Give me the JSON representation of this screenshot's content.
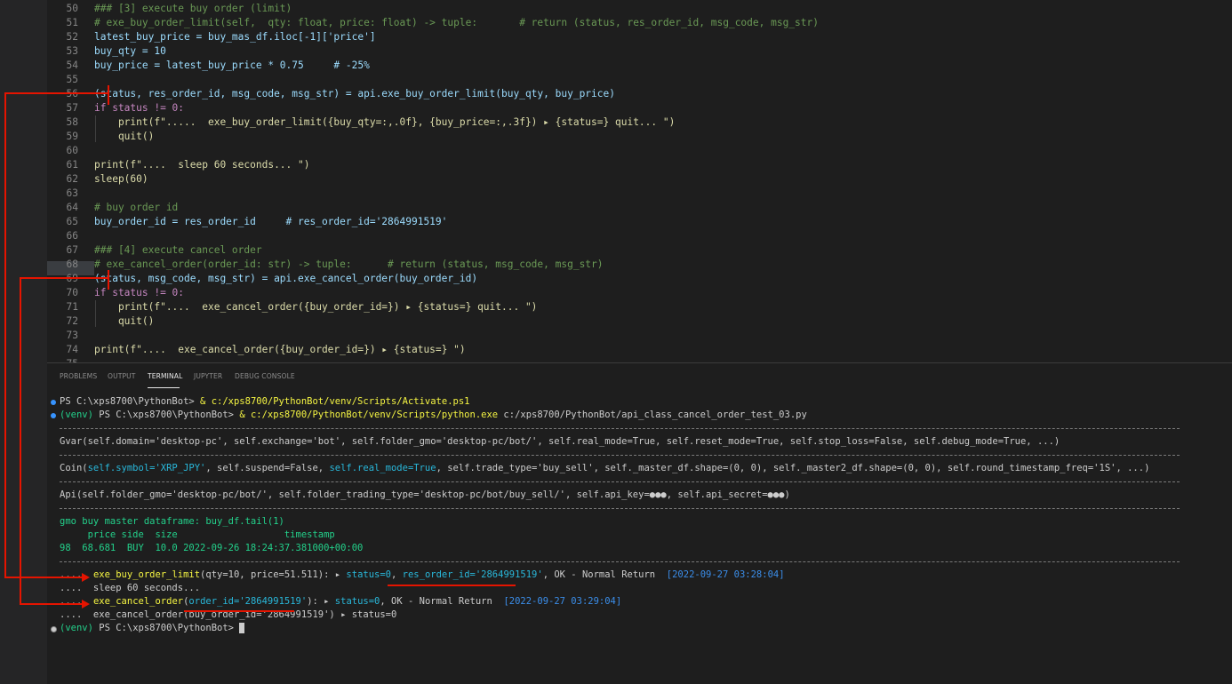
{
  "editor": {
    "lines": [
      {
        "n": "50",
        "text": "### [3] execute buy order (limit)"
      },
      {
        "n": "51",
        "text": "# exe_buy_order_limit(self,  qty: float, price: float) -> tuple:       # return (status, res_order_id, msg_code, msg_str)"
      },
      {
        "n": "52",
        "text": "latest_buy_price = buy_mas_df.iloc[-1]['price']"
      },
      {
        "n": "53",
        "text": "buy_qty = 10"
      },
      {
        "n": "54",
        "text": "buy_price = latest_buy_price * 0.75     # -25%"
      },
      {
        "n": "55",
        "text": ""
      },
      {
        "n": "56",
        "text": "(status, res_order_id, msg_code, msg_str) = api.exe_buy_order_limit(buy_qty, buy_price)"
      },
      {
        "n": "57",
        "text": "if status != 0:"
      },
      {
        "n": "58",
        "text": "    print(f\".....  exe_buy_order_limit({buy_qty=:,.0f}, {buy_price=:,.3f}) ▸ {status=} quit... \")"
      },
      {
        "n": "59",
        "text": "    quit()"
      },
      {
        "n": "60",
        "text": ""
      },
      {
        "n": "61",
        "text": "print(f\"....  sleep 60 seconds... \")"
      },
      {
        "n": "62",
        "text": "sleep(60)"
      },
      {
        "n": "63",
        "text": ""
      },
      {
        "n": "64",
        "text": "# buy order id"
      },
      {
        "n": "65",
        "text": "buy_order_id = res_order_id     # res_order_id='2864991519'"
      },
      {
        "n": "66",
        "text": ""
      },
      {
        "n": "67",
        "text": "### [4] execute cancel order"
      },
      {
        "n": "68",
        "text": "# exe_cancel_order(order_id: str) -> tuple:      # return (status, msg_code, msg_str)"
      },
      {
        "n": "69",
        "text": "(status, msg_code, msg_str) = api.exe_cancel_order(buy_order_id)"
      },
      {
        "n": "70",
        "text": "if status != 0:"
      },
      {
        "n": "71",
        "text": "    print(f\"....  exe_cancel_order({buy_order_id=}) ▸ {status=} quit... \")"
      },
      {
        "n": "72",
        "text": "    quit()"
      },
      {
        "n": "73",
        "text": ""
      },
      {
        "n": "74",
        "text": "print(f\"....  exe_cancel_order({buy_order_id=}) ▸ {status=} \")"
      },
      {
        "n": "75",
        "text": ""
      }
    ]
  },
  "panel": {
    "tabs": [
      "PROBLEMS",
      "OUTPUT",
      "TERMINAL",
      "JUPYTER",
      "DEBUG CONSOLE"
    ],
    "active_tab": "TERMINAL"
  },
  "terminal": {
    "l1_prompt": "PS C:\\xps8700\\PythonBot> ",
    "l1_cmd": "& c:/xps8700/PythonBot/venv/Scripts/Activate.ps1",
    "l2_venv": "(venv)",
    "l2_prompt": " PS C:\\xps8700\\PythonBot> ",
    "l2_cmd": "& c:/xps8700/PythonBot/venv/Scripts/python.exe",
    "l2_arg": " c:/xps8700/PythonBot/api_class_cancel_order_test_03.py",
    "gvar": "Gvar(self.domain='desktop-pc', self.exchange='bot', self.folder_gmo='desktop-pc/bot/', self.real_mode=True, self.reset_mode=True, self.stop_loss=False, self.debug_mode=True, ...)",
    "coin_a": "Coin(",
    "coin_b": "self.symbol='XRP_JPY'",
    "coin_c": ", self.suspend=False, ",
    "coin_d": "self.real_mode=True",
    "coin_e": ", self.trade_type='buy_sell', self._master_df.shape=(0, 0), self._master2_df.shape=(0, 0), self.round_timestamp_freq='1S', ...)",
    "api": "Api(self.folder_gmo='desktop-pc/bot/', self.folder_trading_type='desktop-pc/bot/buy_sell/', self.api_key=●●●, self.api_secret=●●●)",
    "df_title": "gmo buy master dataframe: buy_df.tail(1)",
    "df_header": "     price side  size                   timestamp",
    "df_row": "98  68.681  BUY  10.0 2022-09-26 18:24:37.381000+00:00",
    "buy_prefix": "....  ",
    "buy_call": "exe_buy_order_limit",
    "buy_args": "(qty=10, price=51.511): ▸ ",
    "buy_status": "status=0",
    "buy_comma": ", ",
    "buy_resid": "res_order_id='2864991519'",
    "buy_ok": ", OK - Normal Return  ",
    "buy_time": "[2022-09-27 03:28:04]",
    "sleep": "....  sleep 60 seconds...",
    "cancel_prefix": "....  ",
    "cancel_call": "exe_cancel_order",
    "cancel_paren": "(",
    "cancel_orderid": "order_id='2864991519'",
    "cancel_args": "): ▸ ",
    "cancel_status": "status=0",
    "cancel_ok": ", OK - Normal Return  ",
    "cancel_time": "[2022-09-27 03:29:04]",
    "cancel_done": "....  exe_cancel_order(buy_order_id='2864991519') ▸ status=0",
    "final_venv": "(venv)",
    "final_prompt": " PS C:\\xps8700\\PythonBot> "
  }
}
